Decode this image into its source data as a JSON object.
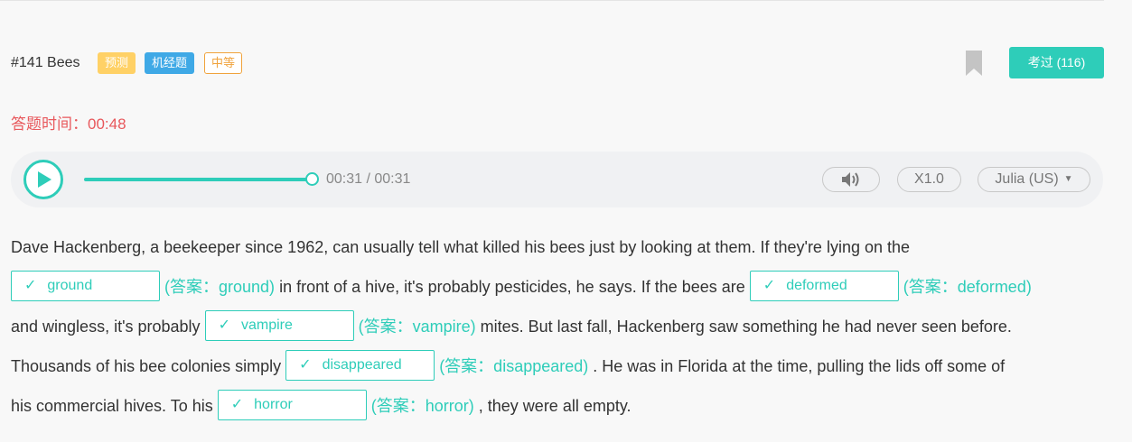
{
  "question": {
    "title": "#141 Bees",
    "tags": {
      "predict": "预测",
      "machine": "机经题",
      "level": "中等"
    },
    "passed_button": "考过 (116)"
  },
  "timer": {
    "label": "答题时间：",
    "value": "00:48"
  },
  "player": {
    "time": "00:31 / 00:31",
    "speed": "X1.0",
    "voice": "Julia (US)",
    "progress": 1.0
  },
  "passage": {
    "p1": "Dave Hackenberg, a beekeeper since 1962, can usually tell what killed his bees just by looking at them. If they're lying on the",
    "p2": " in front of a hive, it's probably pesticides, he says. If the bees are ",
    "p3": "and wingless, it's probably ",
    "p4": " mites. But last fall, Hackenberg saw something he had never seen before.",
    "p5": "Thousands of his bee colonies simply ",
    "p6": " . He was in Florida at the time, pulling the lids off some of",
    "p7": "his commercial hives. To his ",
    "p8": " , they were all empty.",
    "blanks": [
      {
        "input": "ground",
        "answer": "(答案：ground)"
      },
      {
        "input": "deformed",
        "answer": "(答案：deformed)"
      },
      {
        "input": "vampire",
        "answer": "(答案：vampire)"
      },
      {
        "input": "disappeared",
        "answer": "(答案：disappeared)"
      },
      {
        "input": "horror",
        "answer": "(答案：horror)"
      }
    ]
  },
  "colors": {
    "accent": "#2ecdb9",
    "timer": "#e8585c",
    "tag_predict": "#ffd166",
    "tag_machine": "#3fa9e6",
    "tag_level": "#f0a33c"
  }
}
